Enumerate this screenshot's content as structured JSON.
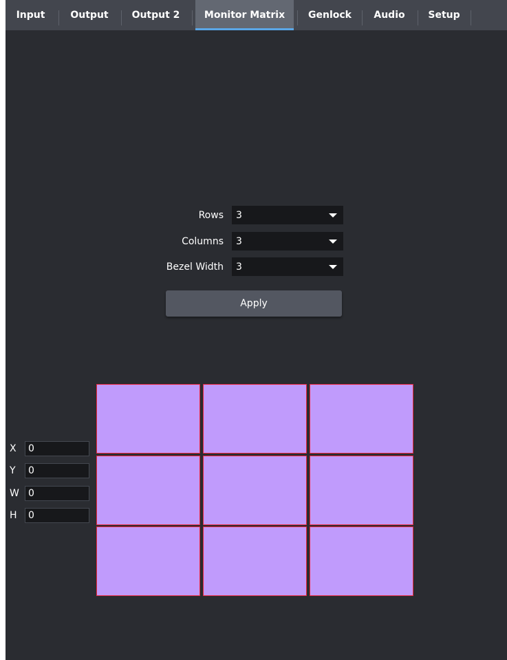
{
  "tabs": [
    {
      "label": "Input"
    },
    {
      "label": "Output"
    },
    {
      "label": "Output 2"
    },
    {
      "label": "Monitor Matrix",
      "active": true
    },
    {
      "label": "Genlock"
    },
    {
      "label": "Audio"
    },
    {
      "label": "Setup"
    }
  ],
  "form": {
    "rows": {
      "label": "Rows",
      "value": "3"
    },
    "columns": {
      "label": "Columns",
      "value": "3"
    },
    "bezel_width": {
      "label": "Bezel Width",
      "value": "3"
    },
    "apply_label": "Apply"
  },
  "matrix": {
    "rows": 3,
    "columns": 3
  },
  "coords": {
    "x": {
      "label": "X",
      "value": "0"
    },
    "y": {
      "label": "Y",
      "value": "0"
    },
    "w": {
      "label": "W",
      "value": "0"
    },
    "h": {
      "label": "H",
      "value": "0"
    }
  },
  "colors": {
    "background": "#2a2c31",
    "tab_bar": "#43464e",
    "tab_active": "#636872",
    "tab_active_indicator": "#5aa7e8",
    "cell_fill": "#c09bfc",
    "cell_border": "#e8263a"
  },
  "icons": {
    "dropdown": "caret-down-icon"
  }
}
